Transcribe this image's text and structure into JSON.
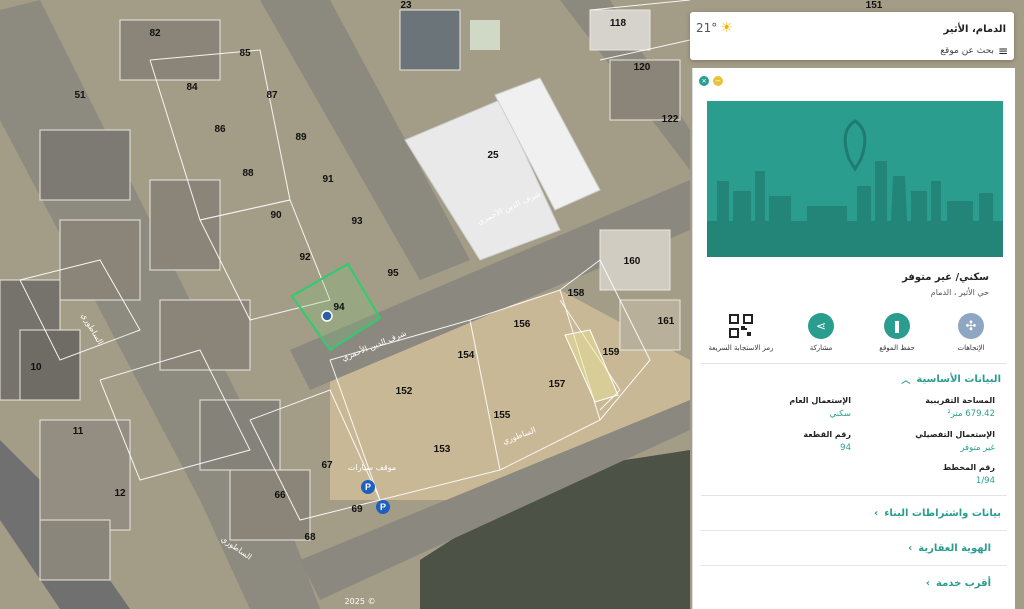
{
  "map": {
    "plot_numbers": [
      "82",
      "85",
      "84",
      "87",
      "86",
      "89",
      "88",
      "91",
      "90",
      "93",
      "92",
      "95",
      "94",
      "118",
      "120",
      "122",
      "160",
      "158",
      "161",
      "159",
      "156",
      "154",
      "157",
      "155",
      "153",
      "152",
      "151",
      "51",
      "10",
      "11",
      "12",
      "23",
      "67",
      "66",
      "69",
      "68",
      "25"
    ],
    "street_labels": [
      "شرف الدين الأحمري",
      "شرف الدين الأحمري",
      "الساطوري",
      "الساطوري",
      "الساطوري"
    ],
    "parking_label": "موقف سيارات",
    "copyright": "2025 ©"
  },
  "topbar": {
    "location": "الدمام، الأثير",
    "temperature": "21°",
    "search_label": "بحث عن موقع",
    "weather_icon": "sun-icon"
  },
  "panel": {
    "close_color": "#2a9d8f",
    "minimize_color": "#e8c23a",
    "title": "سكني/ غير متوفر",
    "subtitle": "حي الأثير ، الدمام",
    "actions": [
      {
        "label": "الإتجاهات",
        "icon": "directions-icon",
        "color": "#8fa6c2"
      },
      {
        "label": "حفظ الموقع",
        "icon": "bookmark-icon",
        "color": "#2a9d8f"
      },
      {
        "label": "مشاركة",
        "icon": "share-icon",
        "color": "#2a9d8f"
      },
      {
        "label": "رمز الاستجابة السريعة",
        "icon": "qr-code-icon",
        "color": "#222222"
      }
    ],
    "basic_section": "البيانات الأساسية",
    "fields": {
      "area_label": "المساحة التقريبية",
      "area_value": "679.42 متر²",
      "general_use_label": "الإستعمال العام",
      "general_use_value": "سكني",
      "detailed_use_label": "الإستعمال التفصيلي",
      "detailed_use_value": "غير متوفر",
      "plot_no_label": "رقم القطعة",
      "plot_no_value": "94",
      "plan_no_label": "رقم المخطط",
      "plan_no_value": "1/94"
    },
    "sections": [
      "بيانات واشتراطات البناء",
      "الهوية العقارية",
      "أقرب خدمة"
    ]
  }
}
